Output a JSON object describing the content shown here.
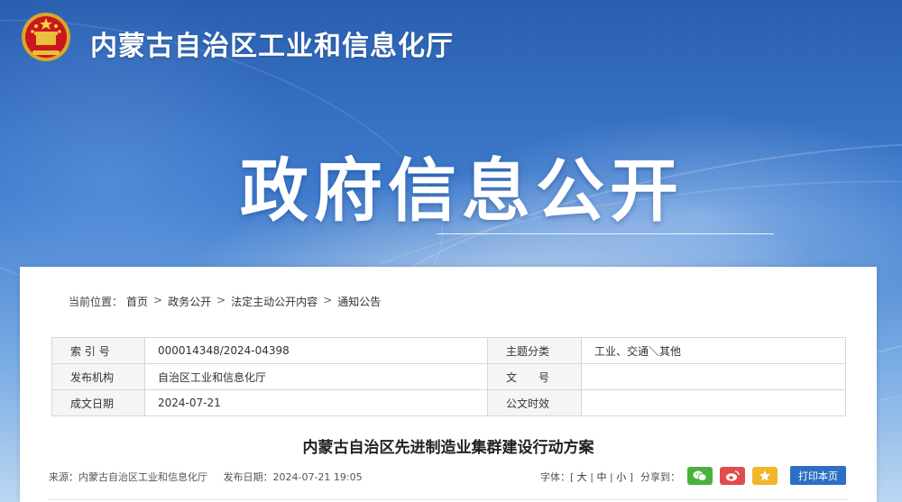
{
  "header": {
    "site_title": "内蒙古自治区工业和信息化厅",
    "hero_title": "政府信息公开"
  },
  "breadcrumb": {
    "prefix": "当前位置：",
    "items": [
      "首页",
      "政务公开",
      "法定主动公开内容",
      "通知公告"
    ]
  },
  "meta_table": {
    "rows": [
      {
        "label1": "索 引 号",
        "value1": "000014348/2024-04398",
        "label2": "主题分类",
        "value2": "工业、交通＼其他"
      },
      {
        "label1": "发布机构",
        "value1": "自治区工业和信息化厅",
        "label2": "文　　号",
        "value2": ""
      },
      {
        "label1": "成文日期",
        "value1": "2024-07-21",
        "label2": "公文时效",
        "value2": ""
      }
    ]
  },
  "article": {
    "title": "内蒙古自治区先进制造业集群建设行动方案",
    "source": "来源：内蒙古自治区工业和信息化厅",
    "publish_date": "发布日期：2024-07-21 19:05"
  },
  "toolbar": {
    "font_label": "字体：",
    "font_open": "[ ",
    "font_large": "大",
    "font_medium": "中",
    "font_small": "小",
    "font_close": " ]",
    "font_sep": " | ",
    "share_label": "分享到：",
    "print_label": "打印本页"
  },
  "colors": {
    "accent": "#2d6fc4",
    "wechat": "#48b33a",
    "weibo": "#e24c4c",
    "favorite": "#f2b52c"
  }
}
